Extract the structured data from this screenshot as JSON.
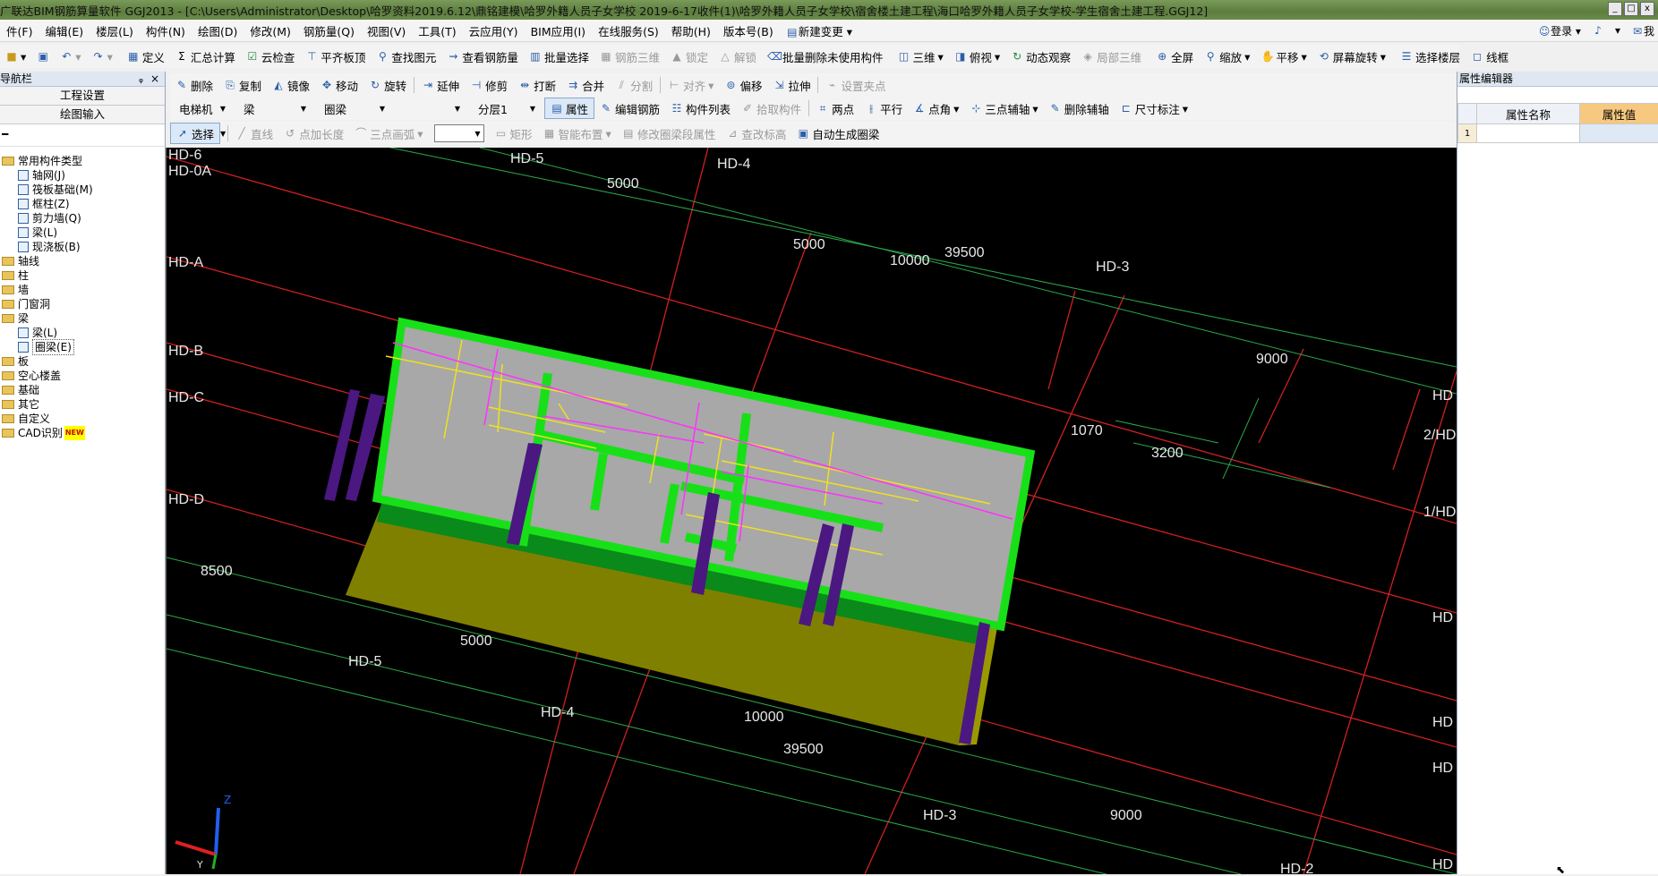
{
  "window": {
    "title": "广联达BIM钢筋算量软件 GGJ2013 - [C:\\Users\\Administrator\\Desktop\\哈罗资料2019.6.12\\鼎铭建模\\哈罗外籍人员子女学校  2019-6-17收件(1)\\哈罗外籍人员子女学校\\宿舍楼土建工程\\海口哈罗外籍人员子女学校-学生宿舍土建工程.GGJ12]",
    "controls": [
      "_",
      "□",
      "x"
    ]
  },
  "menu": {
    "items": [
      "件(F)",
      "编辑(E)",
      "楼层(L)",
      "构件(N)",
      "绘图(D)",
      "修改(M)",
      "钢筋量(Q)",
      "视图(V)",
      "工具(T)",
      "云应用(Y)",
      "BIM应用(I)",
      "在线服务(S)",
      "帮助(H)",
      "版本号(B)",
      "新建变更"
    ],
    "login": "登录",
    "me": "我"
  },
  "toolbar1": [
    "定义",
    "汇总计算",
    "云检查",
    "平齐板顶",
    "查找图元",
    "查看钢筋量",
    "批量选择",
    "钢筋三维",
    "锁定",
    "解锁",
    "批量删除未使用构件",
    "三维",
    "俯视",
    "动态观察",
    "局部三维",
    "全屏",
    "缩放",
    "平移",
    "屏幕旋转",
    "选择楼层",
    "线框"
  ],
  "toolbar2": [
    "删除",
    "复制",
    "镜像",
    "移动",
    "旋转",
    "延伸",
    "修剪",
    "打断",
    "合并",
    "分割",
    "对齐",
    "偏移",
    "拉伸",
    "设置夹点"
  ],
  "toolbar3": {
    "combos": [
      "电梯机",
      "梁",
      "圈梁",
      "",
      "分层1"
    ],
    "buttons": [
      "属性",
      "编辑钢筋",
      "构件列表",
      "拾取构件",
      "两点",
      "平行",
      "点角",
      "三点辅轴",
      "删除辅轴",
      "尺寸标注"
    ]
  },
  "toolbar4": [
    "选择",
    "直线",
    "点加长度",
    "三点画弧",
    "矩形",
    "智能布置",
    "修改圈梁段属性",
    "查改标高",
    "自动生成圈梁"
  ],
  "nav": {
    "title": "导航栏",
    "pin": "ᵩ",
    "close": "×",
    "btn_project": "工程设置",
    "btn_draw": "绘图输入",
    "tree": [
      {
        "label": "常用构件类型",
        "level": 0,
        "type": "folder"
      },
      {
        "label": "轴网(J)",
        "level": 1,
        "type": "item"
      },
      {
        "label": "筏板基础(M)",
        "level": 1,
        "type": "item"
      },
      {
        "label": "框柱(Z)",
        "level": 1,
        "type": "item"
      },
      {
        "label": "剪力墙(Q)",
        "level": 1,
        "type": "item"
      },
      {
        "label": "梁(L)",
        "level": 1,
        "type": "item"
      },
      {
        "label": "现浇板(B)",
        "level": 1,
        "type": "item"
      },
      {
        "label": "轴线",
        "level": 0,
        "type": "folder"
      },
      {
        "label": "柱",
        "level": 0,
        "type": "folder"
      },
      {
        "label": "墙",
        "level": 0,
        "type": "folder"
      },
      {
        "label": "门窗洞",
        "level": 0,
        "type": "folder"
      },
      {
        "label": "梁",
        "level": 0,
        "type": "folder"
      },
      {
        "label": "梁(L)",
        "level": 1,
        "type": "item"
      },
      {
        "label": "圈梁(E)",
        "level": 1,
        "type": "item"
      },
      {
        "label": "板",
        "level": 0,
        "type": "folder"
      },
      {
        "label": "空心楼盖",
        "level": 0,
        "type": "folder"
      },
      {
        "label": "基础",
        "level": 0,
        "type": "folder"
      },
      {
        "label": "其它",
        "level": 0,
        "type": "folder"
      },
      {
        "label": "自定义",
        "level": 0,
        "type": "folder"
      },
      {
        "label": "CAD识别",
        "level": 0,
        "type": "folder"
      }
    ],
    "new_badge": "NEW"
  },
  "properties": {
    "title": "属性编辑器",
    "col_name": "属性名称",
    "col_value": "属性值",
    "row_index": "1"
  },
  "canvas": {
    "axis_labels": [
      "HD-6",
      "HD-0A",
      "HD-A",
      "HD-B",
      "HD-C",
      "HD-D",
      "HD-5",
      "HD-4",
      "HD-3",
      "HD-2",
      "HD",
      "2/HD",
      "1/HD"
    ],
    "dims": [
      "5000",
      "10000",
      "39500",
      "9000",
      "1070",
      "3200",
      "8500"
    ],
    "axes_gizmo": {
      "z": "Z",
      "y": "Y"
    }
  }
}
